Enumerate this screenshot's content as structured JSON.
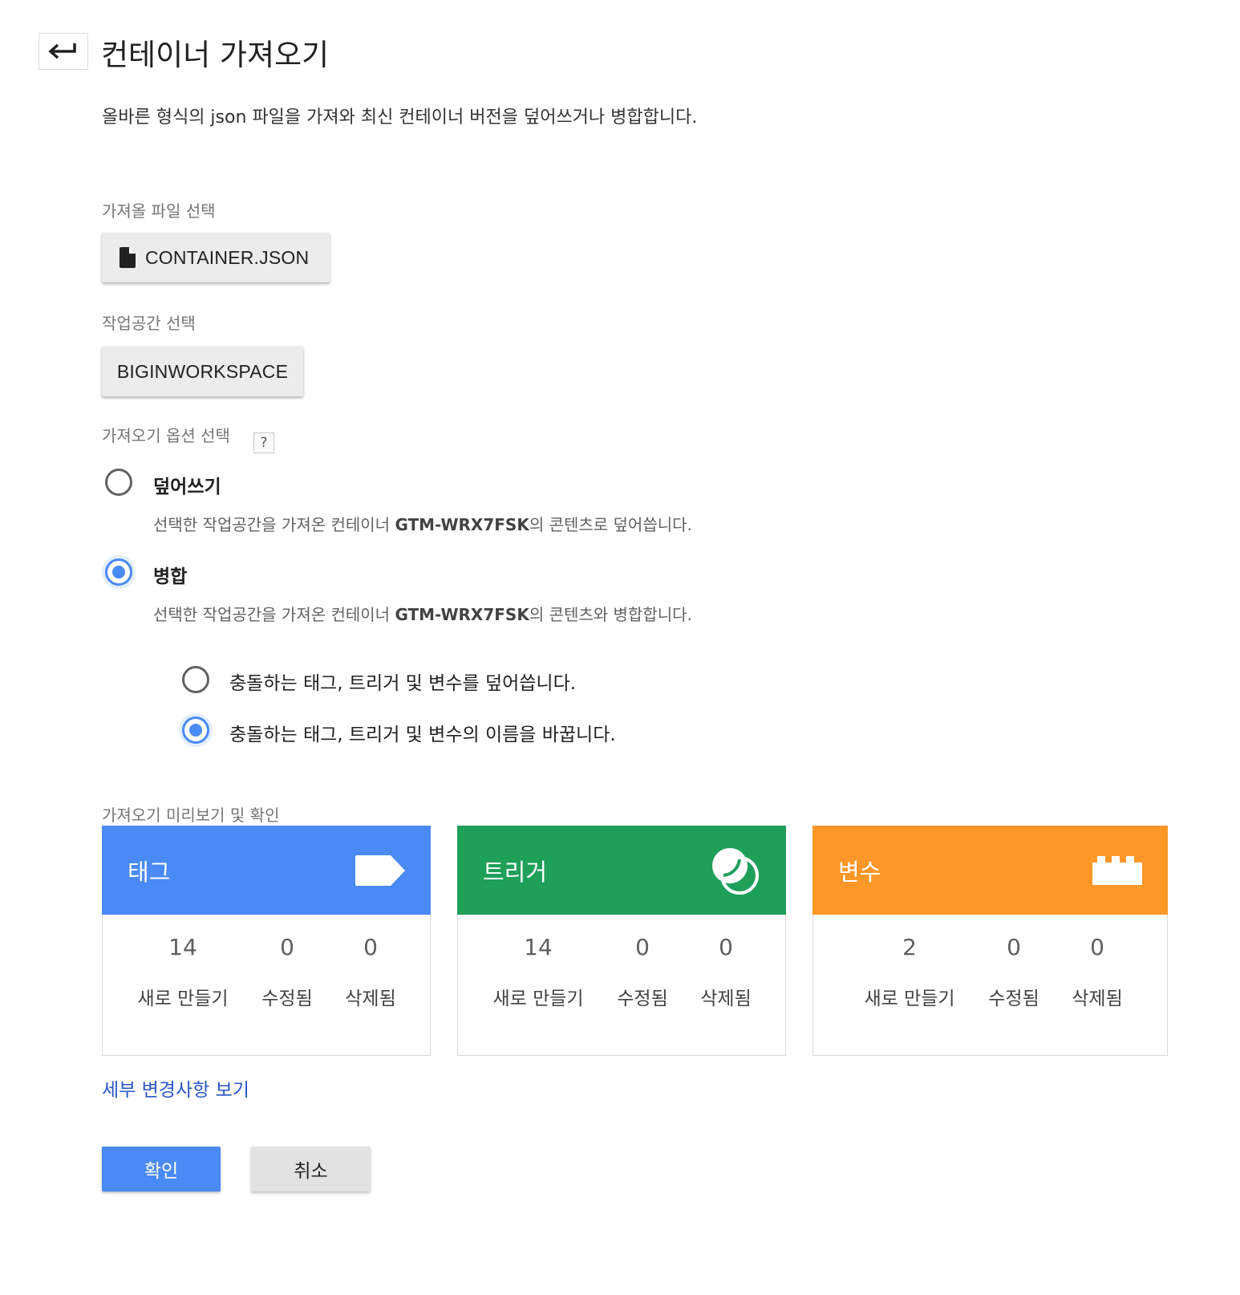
{
  "header": {
    "title": "컨테이너 가져오기",
    "description": "올바른 형식의 json 파일을 가져와 최신 컨테이너 버전을 덮어쓰거나 병합합니다."
  },
  "file_section": {
    "label": "가져올 파일 선택",
    "file_button": "CONTAINER.JSON"
  },
  "workspace_section": {
    "label": "작업공간 선택",
    "workspace_button": "BIGINWORKSPACE"
  },
  "import_options": {
    "label": "가져오기 옵션 선택",
    "help": "?",
    "overwrite": {
      "title": "덮어쓰기",
      "desc_before": "선택한 작업공간을 가져온 컨테이너 ",
      "container_id": "GTM-WRX7FSK",
      "desc_after": "의 콘텐츠로 덮어씁니다.",
      "checked": false
    },
    "merge": {
      "title": "병합",
      "desc_before": "선택한 작업공간을 가져온 컨테이너 ",
      "container_id": "GTM-WRX7FSK",
      "desc_after": "의 콘텐츠와 병합합니다.",
      "checked": true
    },
    "conflict_options": [
      {
        "label": "충돌하는 태그, 트리거 및 변수를 덮어씁니다.",
        "checked": false
      },
      {
        "label": "충돌하는 태그, 트리거 및 변수의 이름을 바꿉니다.",
        "checked": true
      }
    ]
  },
  "preview": {
    "label": "가져오기 미리보기 및 확인",
    "cards": [
      {
        "title": "태그",
        "color": "#4a8af4",
        "icon": "tag-icon",
        "stats": [
          {
            "value": "14",
            "label": "새로 만들기"
          },
          {
            "value": "0",
            "label": "수정됨"
          },
          {
            "value": "0",
            "label": "삭제됨"
          }
        ]
      },
      {
        "title": "트리거",
        "color": "#1fa05a",
        "icon": "trigger-icon",
        "stats": [
          {
            "value": "14",
            "label": "새로 만들기"
          },
          {
            "value": "0",
            "label": "수정됨"
          },
          {
            "value": "0",
            "label": "삭제됨"
          }
        ]
      },
      {
        "title": "변수",
        "color": "#fd9727",
        "icon": "variable-icon",
        "stats": [
          {
            "value": "2",
            "label": "새로 만들기"
          },
          {
            "value": "0",
            "label": "수정됨"
          },
          {
            "value": "0",
            "label": "삭제됨"
          }
        ]
      }
    ],
    "details_link": "세부 변경사항 보기"
  },
  "actions": {
    "confirm": "확인",
    "cancel": "취소"
  }
}
